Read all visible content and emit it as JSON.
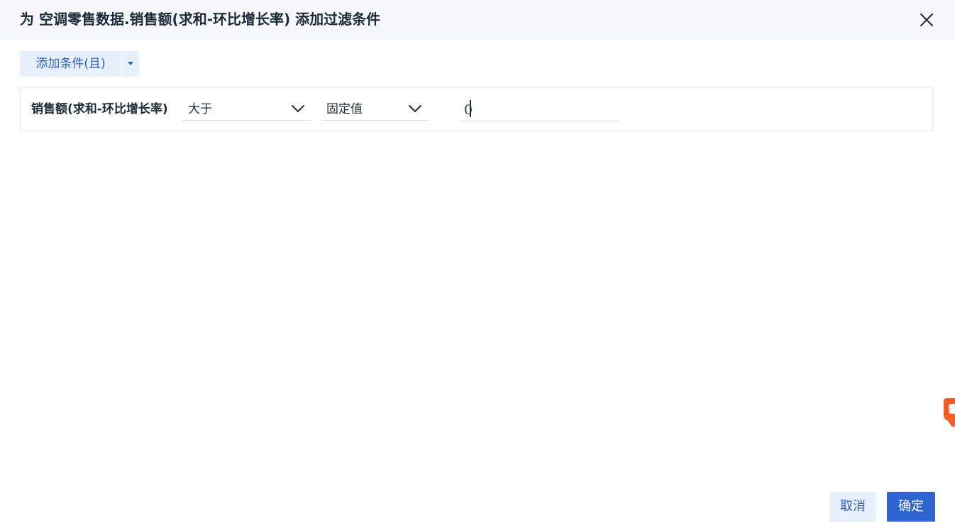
{
  "dialog": {
    "title": "为 空调零售数据.销售额(求和-环比增长率) 添加过滤条件"
  },
  "toolbar": {
    "add_condition_label": "添加条件(且)"
  },
  "condition": {
    "field_label": "销售额(求和-环比增长率)",
    "operator": "大于",
    "value_type": "固定值",
    "value": "0"
  },
  "footer": {
    "cancel_label": "取消",
    "ok_label": "确定"
  },
  "colors": {
    "accent": "#2f63d1",
    "accent_light": "#e8f0fd",
    "header_bg": "#f6f8fb",
    "side_widget": "#ff5a1f"
  },
  "icons": {
    "close": "close-icon",
    "dropdown_caret": "caret-down-icon",
    "chevron": "chevron-down-icon"
  }
}
